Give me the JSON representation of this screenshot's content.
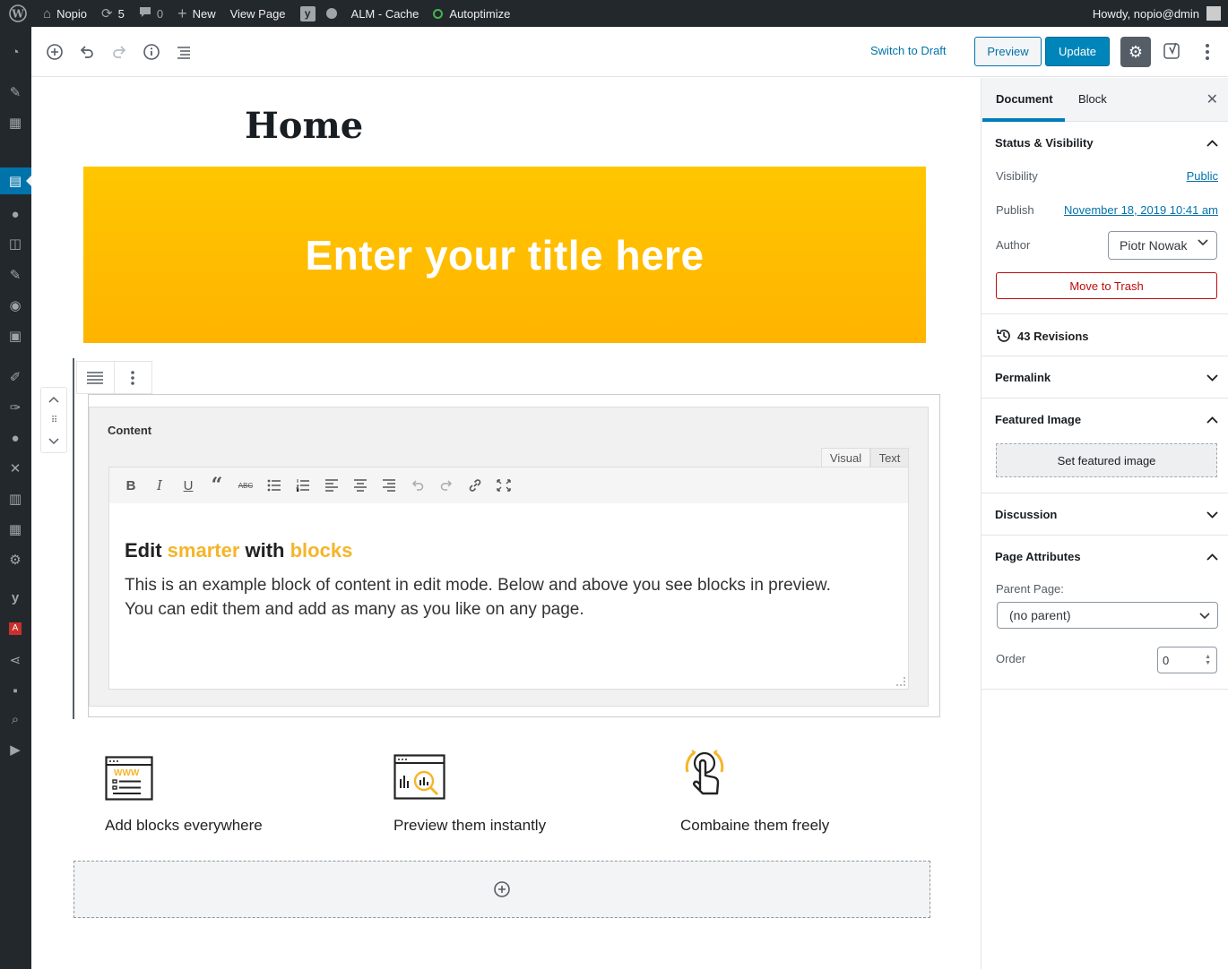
{
  "admin_bar": {
    "site_name": "Nopio",
    "updates_count": "5",
    "comments_count": "0",
    "new_label": "New",
    "view_page_label": "View Page",
    "alm_cache_label": "ALM - Cache",
    "autoptimize_label": "Autoptimize",
    "howdy_label": "Howdy, nopio@dmin"
  },
  "toolbar": {
    "switch_to_draft": "Switch to Draft",
    "preview": "Preview",
    "update": "Update"
  },
  "editor": {
    "page_title": "Home",
    "hero_title": "Enter your title here",
    "acf_label": "Content",
    "tab_visual": "Visual",
    "tab_text": "Text",
    "heading_part1": "Edit ",
    "heading_part2": "smarter",
    "heading_part3": " with ",
    "heading_part4": "blocks",
    "body_text": "This is an example block of content in edit mode. Below and above you see blocks in preview. You can edit them and add as many as you like on any page.",
    "accent_color": "#f5b52a"
  },
  "features": [
    {
      "label": "Add blocks everywhere",
      "icon": "www-browser-icon"
    },
    {
      "label": "Preview them instantly",
      "icon": "analytics-browser-icon"
    },
    {
      "label": "Combaine them freely",
      "icon": "tap-gesture-icon"
    }
  ],
  "settings_panel": {
    "tab_document": "Document",
    "tab_block": "Block",
    "status_visibility_title": "Status & Visibility",
    "visibility_label": "Visibility",
    "visibility_value": "Public",
    "publish_label": "Publish",
    "publish_value": "November 18, 2019 10:41 am",
    "author_label": "Author",
    "author_value": "Piotr Nowak",
    "move_to_trash": "Move to Trash",
    "revisions": "43 Revisions",
    "permalink_title": "Permalink",
    "featured_image_title": "Featured Image",
    "set_featured_image": "Set featured image",
    "discussion_title": "Discussion",
    "page_attributes_title": "Page Attributes",
    "parent_page_label": "Parent Page:",
    "parent_page_value": "(no parent)",
    "order_label": "Order",
    "order_value": "0"
  },
  "colors": {
    "admin_bar_bg": "#23282d",
    "primary": "#0085ba",
    "hero_yellow": "#ffc600",
    "trash_red": "#bc0b0b"
  }
}
